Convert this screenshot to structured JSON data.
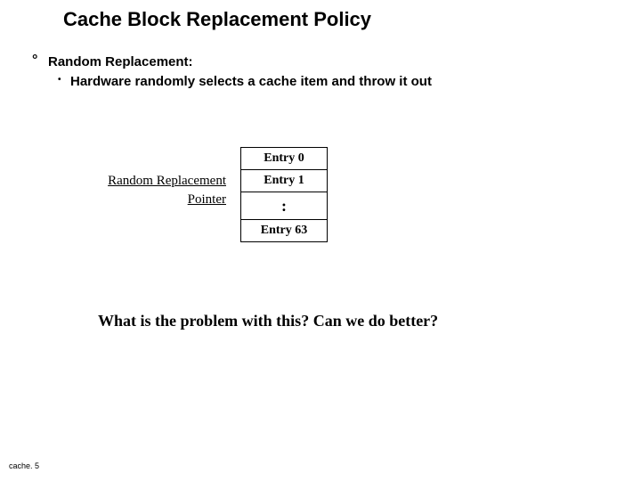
{
  "title": "Cache Block Replacement Policy",
  "bullet": {
    "main": "Random Replacement:",
    "sub": "Hardware randomly selects a cache item and throw it out"
  },
  "diagram": {
    "label_line1": "Random Replacement",
    "label_line2": "Pointer",
    "entries": [
      "Entry 0",
      "Entry 1",
      ":",
      "Entry 63"
    ]
  },
  "question": "What is the problem with this? Can we do better?",
  "footer": "cache. 5"
}
